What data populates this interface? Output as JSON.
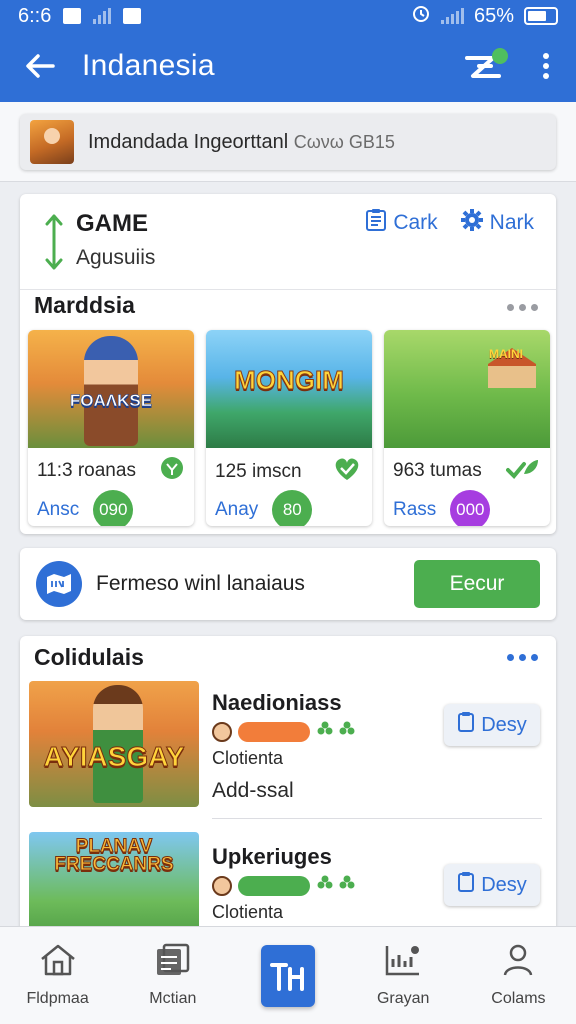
{
  "statusbar": {
    "time": "6::6",
    "battery": "65%"
  },
  "header": {
    "title": "Indanesia",
    "back_icon": "arrow-left-icon",
    "logo_icon": "app-logo-icon",
    "more_icon": "more-vertical-icon"
  },
  "search": {
    "text": "Imdandada Ingeorttanl",
    "suffix": "Cωνω GB15"
  },
  "game_card": {
    "title": "GAME",
    "subtitle": "Agusuiis",
    "links": [
      {
        "label": "Cark",
        "icon": "clipboard-icon"
      },
      {
        "label": "Nark",
        "icon": "gear-icon"
      }
    ],
    "section_title": "Marddsia",
    "tiles": [
      {
        "image_label": "FOAΛKSE",
        "stat": "11:3 roanas",
        "label": "Ansc",
        "badge": "090",
        "badge_color": "#4cae4f"
      },
      {
        "image_label": "MONGIM",
        "stat": "125 imscn",
        "label": "Anay",
        "badge": "80",
        "badge_color": "#4cae4f"
      },
      {
        "image_label": "MAINI",
        "stat": "963 tumas",
        "label": "Rass",
        "badge": "000",
        "badge_color": "#a63de0"
      }
    ]
  },
  "promo": {
    "text": "Fermeso winl lanaiaus",
    "button": "Eecur"
  },
  "list_card": {
    "title": "Colidulais",
    "items": [
      {
        "image_label": "AYIASGAY",
        "title": "Naedioniass",
        "sub": "Clotienta",
        "sub2": "Add-ssal",
        "button": "Desy",
        "bar_color": "#f27d3a"
      },
      {
        "image_label": "PLANAV FRECCANRS",
        "title": "Upkeriuges",
        "sub": "Clotienta",
        "sub2": "",
        "button": "Desy",
        "bar_color": "#4cae4f"
      }
    ]
  },
  "bottom_nav": [
    {
      "label": "Fldpmaa",
      "icon": "home-icon"
    },
    {
      "label": "Mctian",
      "icon": "gallery-icon"
    },
    {
      "label": "",
      "icon": "app-center-icon"
    },
    {
      "label": "Grayan",
      "icon": "chart-icon"
    },
    {
      "label": "Colams",
      "icon": "person-icon"
    }
  ],
  "colors": {
    "primary": "#2f6fd6",
    "success": "#4cae4f",
    "purple": "#a63de0",
    "orange": "#f27d3a"
  }
}
